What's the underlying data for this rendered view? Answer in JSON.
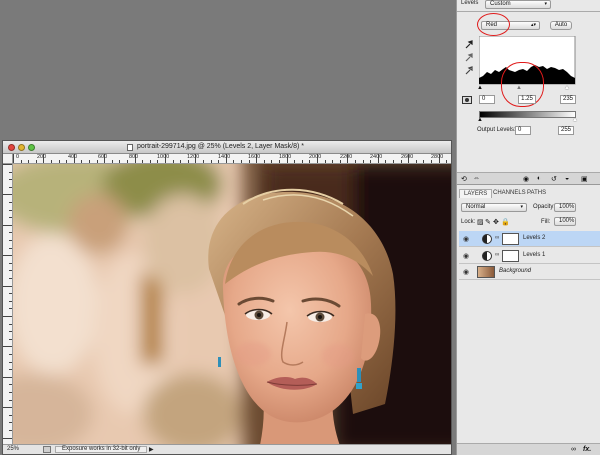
{
  "levels_panel": {
    "title": "Levels",
    "preset": "Custom",
    "channel": "Red",
    "auto_label": "Auto",
    "input_black": "0",
    "input_gamma": "1.25",
    "input_white": "235",
    "output_label": "Output Levels:",
    "output_black": "0",
    "output_white": "255"
  },
  "panel_tabs": [
    "LAYERS",
    "CHANNELS",
    "PATHS"
  ],
  "layers_panel": {
    "blend_mode": "Normal",
    "opacity_label": "Opacity:",
    "opacity": "100%",
    "lock_label": "Lock:",
    "fill_label": "Fill:",
    "fill": "100%",
    "layers": [
      {
        "name": "Levels 2",
        "selected": true
      },
      {
        "name": "Levels 1",
        "selected": false
      },
      {
        "name": "Background",
        "selected": false
      }
    ]
  },
  "document": {
    "title": "portrait-299714.jpg @ 25% (Levels 2, Layer Mask/8) *",
    "ruler_labels": [
      "0",
      "200",
      "400",
      "600",
      "800",
      "1000",
      "1200",
      "1400",
      "1600",
      "1800",
      "2000",
      "2200",
      "2400",
      "2600",
      "2800"
    ],
    "zoom": "25%",
    "status_text": "Exposure works in 32-bit only"
  },
  "colors": {
    "annotation": "#e01a1a",
    "selection": "#bcd6f5",
    "background": "#7a7a7a"
  },
  "icons": [
    "close-icon",
    "minimize-icon",
    "zoom-icon",
    "document-icon",
    "eyedropper-icon",
    "eye-icon",
    "link-icon",
    "adjustment-layer-icon",
    "fx-icon"
  ]
}
